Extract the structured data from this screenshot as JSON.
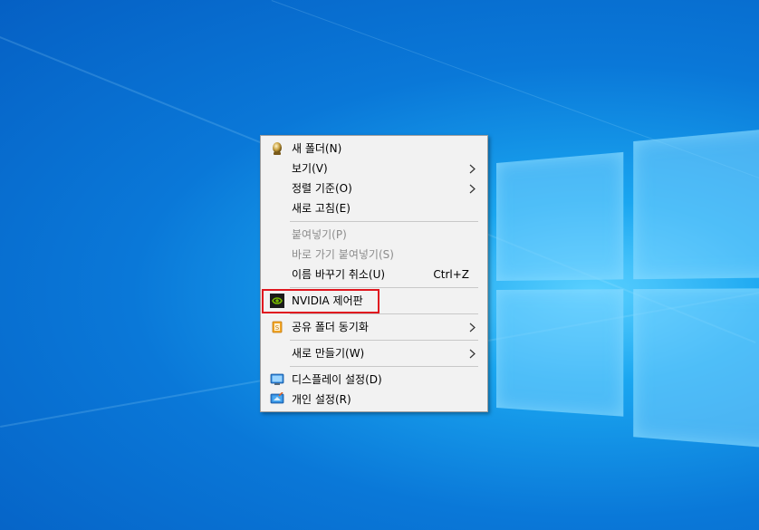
{
  "menu": {
    "items": [
      {
        "label": "새 폴더(N)",
        "icon": "gold-orb-icon"
      },
      {
        "label": "보기(V)",
        "submenu": true
      },
      {
        "label": "정렬 기준(O)",
        "submenu": true
      },
      {
        "label": "새로 고침(E)"
      },
      {
        "label": "붙여넣기(P)",
        "disabled": true
      },
      {
        "label": "바로 가기 붙여넣기(S)",
        "disabled": true
      },
      {
        "label": "이름 바꾸기 취소(U)",
        "shortcut": "Ctrl+Z"
      },
      {
        "label": "NVIDIA 제어판",
        "icon": "nvidia-icon"
      },
      {
        "label": "공유 폴더 동기화",
        "icon": "sync-icon",
        "submenu": true
      },
      {
        "label": "새로 만들기(W)",
        "submenu": true
      },
      {
        "label": "디스플레이 설정(D)",
        "icon": "display-icon"
      },
      {
        "label": "개인 설정(R)",
        "icon": "personalize-icon"
      }
    ]
  },
  "colors": {
    "highlight": "#e0171f",
    "menu_bg": "#f2f2f2",
    "nvidia_green": "#76b900"
  }
}
